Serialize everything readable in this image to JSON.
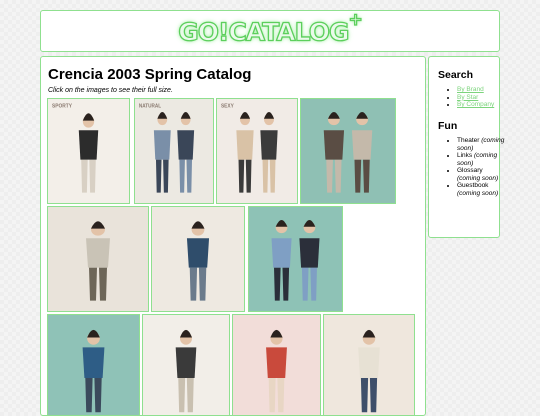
{
  "header": {
    "logo_text": "GO!CATALOG",
    "logo_plus": "+"
  },
  "main": {
    "title": "Crencia 2003 Spring Catalog",
    "hint": "Click on the images to see their full size."
  },
  "gallery": [
    {
      "name": "catalog-page-1",
      "bg": "#f3efe9",
      "figures": 1,
      "caption": "SPORTY"
    },
    {
      "name": "catalog-page-2",
      "bg": "#ece9e2",
      "figures": 2,
      "caption": "NATURAL"
    },
    {
      "name": "catalog-page-3",
      "bg": "#f1ebe6",
      "figures": 2,
      "caption": "SEXY"
    },
    {
      "name": "catalog-page-4",
      "bg": "#8fc0b4",
      "figures": 2,
      "caption": ""
    },
    {
      "name": "catalog-page-5",
      "bg": "#e9e3da",
      "figures": 1,
      "caption": ""
    },
    {
      "name": "catalog-page-6",
      "bg": "#eee9e1",
      "figures": 1,
      "caption": ""
    },
    {
      "name": "catalog-page-7",
      "bg": "#8ec2b6",
      "figures": 2,
      "caption": ""
    },
    {
      "name": "catalog-page-8",
      "bg": "#8fc2b7",
      "figures": 1,
      "caption": ""
    },
    {
      "name": "catalog-page-9",
      "bg": "#f2eee8",
      "figures": 1,
      "caption": ""
    },
    {
      "name": "catalog-page-10",
      "bg": "#f2ddd9",
      "figures": 1,
      "caption": ""
    },
    {
      "name": "catalog-page-11",
      "bg": "#efe7dd",
      "figures": 1,
      "caption": ""
    }
  ],
  "sidebar": {
    "search_heading": "Search",
    "search_links": [
      {
        "label": "By Brand"
      },
      {
        "label": "By Star"
      },
      {
        "label": "By Company"
      }
    ],
    "fun_heading": "Fun",
    "fun_items": [
      {
        "label": "Theater",
        "note": "(coming soon)"
      },
      {
        "label": "Links",
        "note": "(coming soon)"
      },
      {
        "label": "Glossary",
        "note": "(coming soon)"
      },
      {
        "label": "Guestbook",
        "note": "(coming soon)"
      }
    ]
  },
  "colors": {
    "accent_border": "#8fe08f",
    "link": "#7cd47c",
    "logo_outline": "#5ccf5c"
  }
}
